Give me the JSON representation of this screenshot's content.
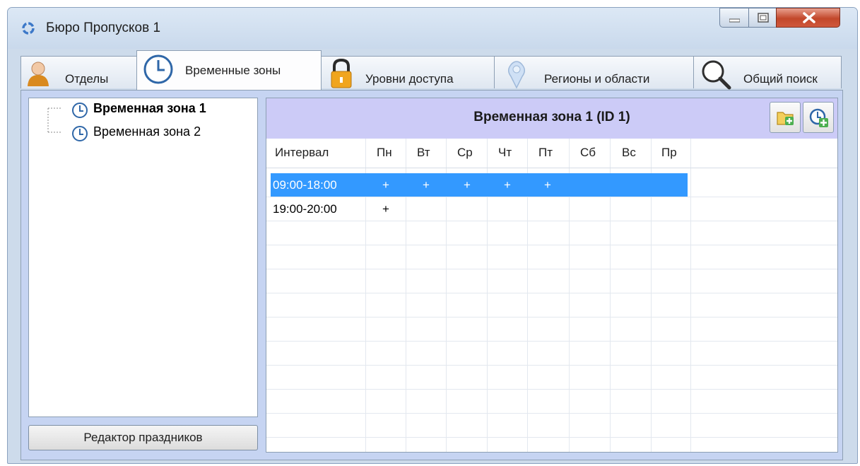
{
  "window": {
    "title": "Бюро Пропусков 1",
    "controls": {
      "minimize": "minimize",
      "maximize": "maximize",
      "close": "close"
    }
  },
  "tabs": [
    {
      "label": "Отделы",
      "icon": "person-icon",
      "active": false
    },
    {
      "label": "Временные зоны",
      "icon": "clock-icon",
      "active": true
    },
    {
      "label": "Уровни доступа",
      "icon": "padlock-icon",
      "active": false
    },
    {
      "label": "Регионы и области",
      "icon": "location-pin-icon",
      "active": false
    },
    {
      "label": "Общий поиск",
      "icon": "magnifier-icon",
      "active": false
    }
  ],
  "tree": {
    "items": [
      {
        "label": "Временная зона 1",
        "selected": true
      },
      {
        "label": "Временная зона 2",
        "selected": false
      }
    ]
  },
  "holiday_button": {
    "label": "Редактор праздников"
  },
  "zone_panel": {
    "title": "Временная зона 1 (ID 1)",
    "buttons": [
      {
        "name": "add-folder",
        "icon": "folder-add-icon"
      },
      {
        "name": "add-interval",
        "icon": "clock-add-icon"
      }
    ]
  },
  "schedule": {
    "columns": [
      "Интервал",
      "Пн",
      "Вт",
      "Ср",
      "Чт",
      "Пт",
      "Сб",
      "Вс",
      "Пр"
    ],
    "rows": [
      {
        "interval": "09:00-18:00",
        "days": [
          "+",
          "+",
          "+",
          "+",
          "+",
          "",
          "",
          ""
        ],
        "selected": true
      },
      {
        "interval": "19:00-20:00",
        "days": [
          "+",
          "",
          "",
          "",
          "",
          "",
          "",
          ""
        ],
        "selected": false
      }
    ]
  },
  "colors": {
    "selection": "#3399ff",
    "header_bg": "#cccbf7",
    "frame_bg": "#c6d4f2",
    "close_button": "#c2472a"
  }
}
